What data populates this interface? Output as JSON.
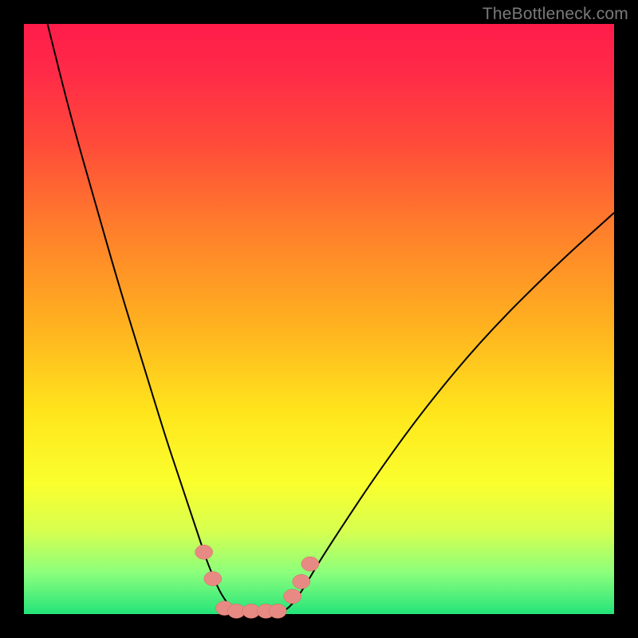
{
  "watermark": "TheBottleneck.com",
  "chart_data": {
    "type": "line",
    "title": "",
    "xlabel": "",
    "ylabel": "",
    "xlim": [
      0,
      100
    ],
    "ylim": [
      0,
      100
    ],
    "grid": false,
    "legend": false,
    "background": "rainbow-gradient-red-to-green",
    "series": [
      {
        "name": "bottleneck-curve-left",
        "x": [
          4,
          8,
          12,
          16,
          20,
          24,
          26,
          28,
          30,
          31,
          32,
          33,
          34,
          35,
          36
        ],
        "y": [
          100,
          84,
          70,
          56,
          43,
          30,
          24,
          18,
          12,
          9,
          6.5,
          4.2,
          2.5,
          1.2,
          0.5
        ]
      },
      {
        "name": "bottleneck-curve-right",
        "x": [
          44,
          45,
          46,
          47,
          48,
          50,
          54,
          60,
          68,
          78,
          90,
          100
        ],
        "y": [
          0.5,
          1.2,
          2.4,
          3.8,
          5.4,
          8.8,
          15,
          24,
          35,
          47,
          59,
          68
        ]
      }
    ],
    "markers": [
      {
        "name": "left-high",
        "x": 30.5,
        "y": 10.5
      },
      {
        "name": "left-low",
        "x": 32.0,
        "y": 6.0
      },
      {
        "name": "floor-1",
        "x": 34.0,
        "y": 1.0
      },
      {
        "name": "floor-2",
        "x": 36.0,
        "y": 0.5
      },
      {
        "name": "floor-3",
        "x": 38.5,
        "y": 0.5
      },
      {
        "name": "floor-4",
        "x": 41.0,
        "y": 0.5
      },
      {
        "name": "floor-5",
        "x": 43.0,
        "y": 0.5
      },
      {
        "name": "right-low",
        "x": 45.5,
        "y": 3.0
      },
      {
        "name": "right-mid",
        "x": 47.0,
        "y": 5.5
      },
      {
        "name": "right-high",
        "x": 48.5,
        "y": 8.5
      }
    ],
    "colors": {
      "curve": "#000000",
      "markers": "#e88a84",
      "gradient_stops": [
        "#ff1c4a",
        "#ff7c2c",
        "#ffe61c",
        "#24e47a"
      ]
    }
  }
}
